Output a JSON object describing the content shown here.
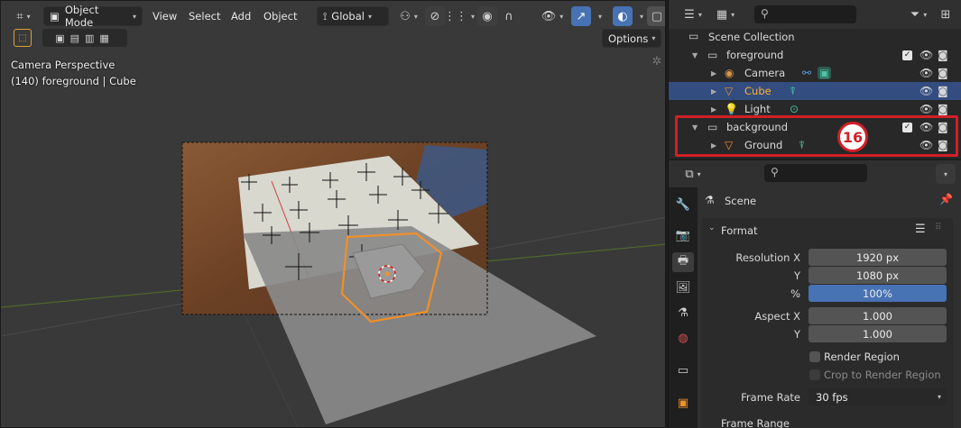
{
  "viewport": {
    "mode_label": "Object Mode",
    "menus": [
      "View",
      "Select",
      "Add",
      "Object"
    ],
    "transform_orientation": "Global",
    "options_label": "Options",
    "overlay_line1": "Camera Perspective",
    "overlay_line2": "(140) foreground | Cube"
  },
  "outliner": {
    "scene_collection": "Scene Collection",
    "rows": [
      {
        "label": "foreground",
        "type": "collection"
      },
      {
        "label": "Camera",
        "type": "camera"
      },
      {
        "label": "Cube",
        "type": "mesh",
        "selected": true
      },
      {
        "label": "Light",
        "type": "light"
      },
      {
        "label": "background",
        "type": "collection"
      },
      {
        "label": "Ground",
        "type": "mesh"
      }
    ],
    "step_badge": "16"
  },
  "properties": {
    "context": "Scene",
    "panel_title": "Format",
    "resolution_x_label": "Resolution X",
    "resolution_x": "1920 px",
    "resolution_y_label": "Y",
    "resolution_y": "1080 px",
    "percent_label": "%",
    "percent": "100%",
    "aspect_x_label": "Aspect X",
    "aspect_x": "1.000",
    "aspect_y_label": "Y",
    "aspect_y": "1.000",
    "render_region_label": "Render Region",
    "crop_label": "Crop to Render Region",
    "frame_rate_label": "Frame Rate",
    "frame_rate": "30 fps",
    "next_panel": "Frame Range"
  },
  "colors": {
    "selection_blue": "#334d80",
    "active_orange": "#ffaf29",
    "annotation_red": "#d21f26",
    "field_blue": "#4772b3"
  }
}
